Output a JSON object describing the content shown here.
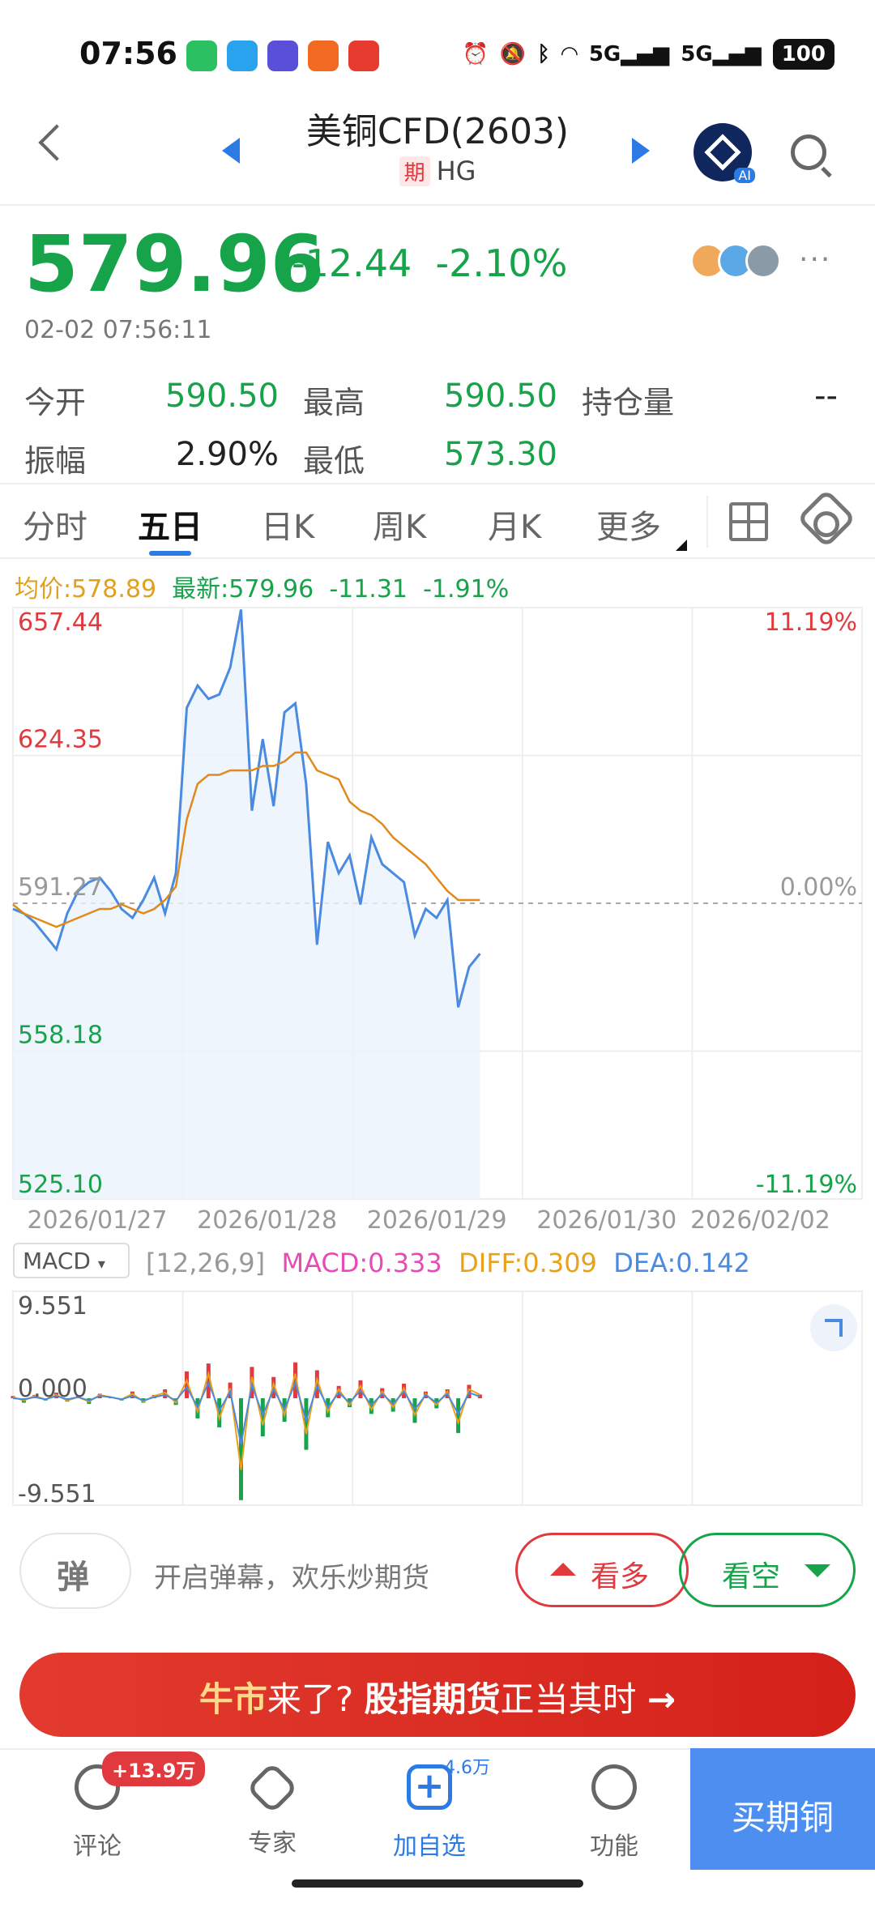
{
  "status_bar": {
    "time": "07:56",
    "signal_1": "5G",
    "signal_2": "5G",
    "battery": "100"
  },
  "header": {
    "title": "美铜CFD(2603)",
    "badge": "期",
    "symbol": "HG"
  },
  "quote": {
    "price": "579.96",
    "change": "-12.44",
    "change_pct": "-2.10%",
    "timestamp": "02-02 07:56:11",
    "more": "···"
  },
  "stats": [
    {
      "label": "今开",
      "value": "590.50",
      "label2": "最高",
      "value2": "590.50",
      "label3": "持仓量",
      "value3": "--"
    },
    {
      "label": "振幅",
      "value": "2.90%",
      "label2": "最低",
      "value2": "573.30"
    }
  ],
  "tabs": [
    "分时",
    "五日",
    "日K",
    "周K",
    "月K",
    "更多"
  ],
  "active_tab": 1,
  "legend": {
    "avg": "均价:578.89",
    "latest": "最新:579.96",
    "chg": "-11.31",
    "pct": "-1.91%"
  },
  "colors": {
    "up": "#e0393e",
    "down": "#16a34a",
    "price_line": "#4a8ae0",
    "avg_line": "#e08a1e",
    "accent": "#2c7be5"
  },
  "chart_data": [
    {
      "type": "line",
      "y_left_ticks": [
        "657.44",
        "624.35",
        "591.27",
        "558.18",
        "525.10"
      ],
      "y_right_ticks": [
        "11.19%",
        "",
        "0.00%",
        "",
        "-11.19%"
      ],
      "x_ticks": [
        "2026/01/27",
        "2026/01/28",
        "2026/01/29",
        "2026/01/30",
        "2026/02/02"
      ],
      "ylim": [
        525.1,
        657.44
      ],
      "baseline": 591.27,
      "series": [
        {
          "name": "均价",
          "values": [
            591,
            589,
            588,
            587,
            586,
            587,
            588,
            589,
            590,
            590,
            591,
            590,
            589,
            590,
            592,
            595,
            610,
            618,
            620,
            620,
            621,
            621,
            621,
            622,
            622,
            623,
            625,
            625,
            621,
            620,
            619,
            614,
            612,
            611,
            609,
            606,
            604,
            602,
            600,
            597,
            594,
            592,
            592,
            592
          ]
        },
        {
          "name": "最新",
          "values": [
            590,
            589,
            587,
            584,
            581,
            589,
            594,
            596,
            597,
            594,
            590,
            588,
            592,
            597,
            589,
            598,
            635,
            640,
            637,
            638,
            644,
            657,
            612,
            628,
            613,
            634,
            636,
            618,
            582,
            605,
            598,
            602,
            591,
            606,
            600,
            598,
            596,
            584,
            590,
            588,
            592,
            568,
            577,
            580
          ]
        }
      ]
    },
    {
      "type": "line",
      "title": "MACD",
      "params": "[12,26,9]",
      "y_ticks": [
        "9.551",
        "0.000",
        "-9.551"
      ],
      "ylim": [
        -9.551,
        9.551
      ],
      "series": [
        {
          "name": "MACD",
          "values": [
            0.2,
            -0.4,
            0.3,
            -0.2,
            0.5,
            -0.3,
            0.2,
            -0.5,
            0.4,
            0.1,
            -0.2,
            0.6,
            -0.4,
            0.3,
            0.8,
            -0.6,
            2.4,
            -1.8,
            3.1,
            -2.6,
            1.4,
            -9.1,
            2.8,
            -3.4,
            1.9,
            -2.1,
            3.2,
            -4.6,
            2.5,
            -1.7,
            1.1,
            -0.8,
            1.6,
            -1.4,
            0.9,
            -1.2,
            1.3,
            -2.2,
            0.6,
            -0.9,
            0.8,
            -3.1,
            1.2,
            0.333
          ]
        },
        {
          "name": "DIFF",
          "values": [
            0.1,
            -0.2,
            0.2,
            -0.1,
            0.3,
            -0.2,
            0.1,
            -0.3,
            0.3,
            0.1,
            -0.1,
            0.4,
            -0.3,
            0.2,
            0.5,
            -0.4,
            1.6,
            -1.2,
            2.2,
            -1.8,
            0.9,
            -6.4,
            1.9,
            -2.4,
            1.3,
            -1.5,
            2.2,
            -3.2,
            1.7,
            -1.2,
            0.8,
            -0.6,
            1.1,
            -1.0,
            0.6,
            -0.8,
            0.9,
            -1.5,
            0.4,
            -0.6,
            0.6,
            -2.2,
            0.8,
            0.309
          ]
        },
        {
          "name": "DEA",
          "values": [
            0.0,
            -0.1,
            0.1,
            -0.1,
            0.2,
            -0.1,
            0.1,
            -0.2,
            0.2,
            0.1,
            -0.1,
            0.2,
            -0.2,
            0.1,
            0.3,
            -0.2,
            1.0,
            -0.8,
            1.4,
            -1.1,
            0.6,
            -4.1,
            1.2,
            -1.5,
            0.8,
            -1.0,
            1.4,
            -2.0,
            1.1,
            -0.8,
            0.5,
            -0.4,
            0.7,
            -0.6,
            0.4,
            -0.5,
            0.6,
            -1.0,
            0.3,
            -0.4,
            0.4,
            -1.4,
            0.5,
            0.142
          ]
        }
      ]
    }
  ],
  "macd": {
    "selector": "MACD",
    "params": "[12,26,9]",
    "macd": "MACD:0.333",
    "diff": "DIFF:0.309",
    "dea": "DEA:0.142"
  },
  "danmu": {
    "toggle": "弹",
    "hint": "开启弹幕，欢乐炒期货"
  },
  "actions": {
    "bull": "看多",
    "bear": "看空"
  },
  "banner": {
    "part1": "牛市",
    "part2": "来了?",
    "part3": "股指期货",
    "part4": "正当其时",
    "arrow": "→"
  },
  "bottom_nav": {
    "items": [
      "评论",
      "专家",
      "加自选",
      "功能"
    ],
    "comment_badge": "+13.9万",
    "watch_count": "4.6万",
    "buy": "买期铜"
  }
}
